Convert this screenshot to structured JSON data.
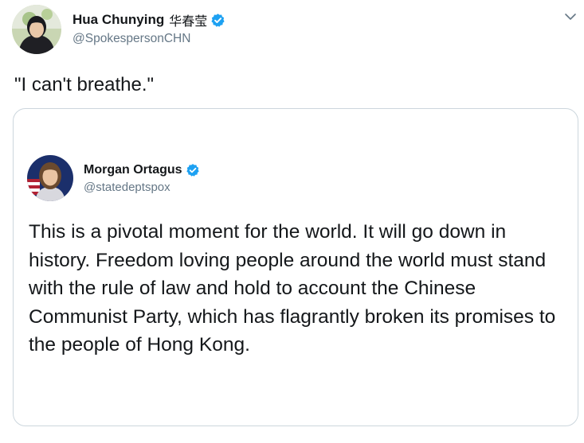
{
  "tweet": {
    "author": {
      "name": "Hua Chunying",
      "name_cn": "华春莹",
      "handle": "@SpokespersonCHN",
      "verified": true
    },
    "text": "\"I can't breathe.\"",
    "menu_icon": "chevron-down-icon"
  },
  "quoted_tweet": {
    "author": {
      "name": "Morgan Ortagus",
      "handle": "@statedeptspox",
      "verified": true
    },
    "text": "This is a pivotal moment for the world. It will go down in history. Freedom loving people around the world must stand with the rule of law and hold to account the Chinese Communist Party, which has flagrantly broken its promises to the people of Hong Kong."
  },
  "colors": {
    "verified_badge": "#1da1f2",
    "handle_text": "#657786",
    "card_border": "#ccd6dd",
    "body_text": "#14171a"
  }
}
